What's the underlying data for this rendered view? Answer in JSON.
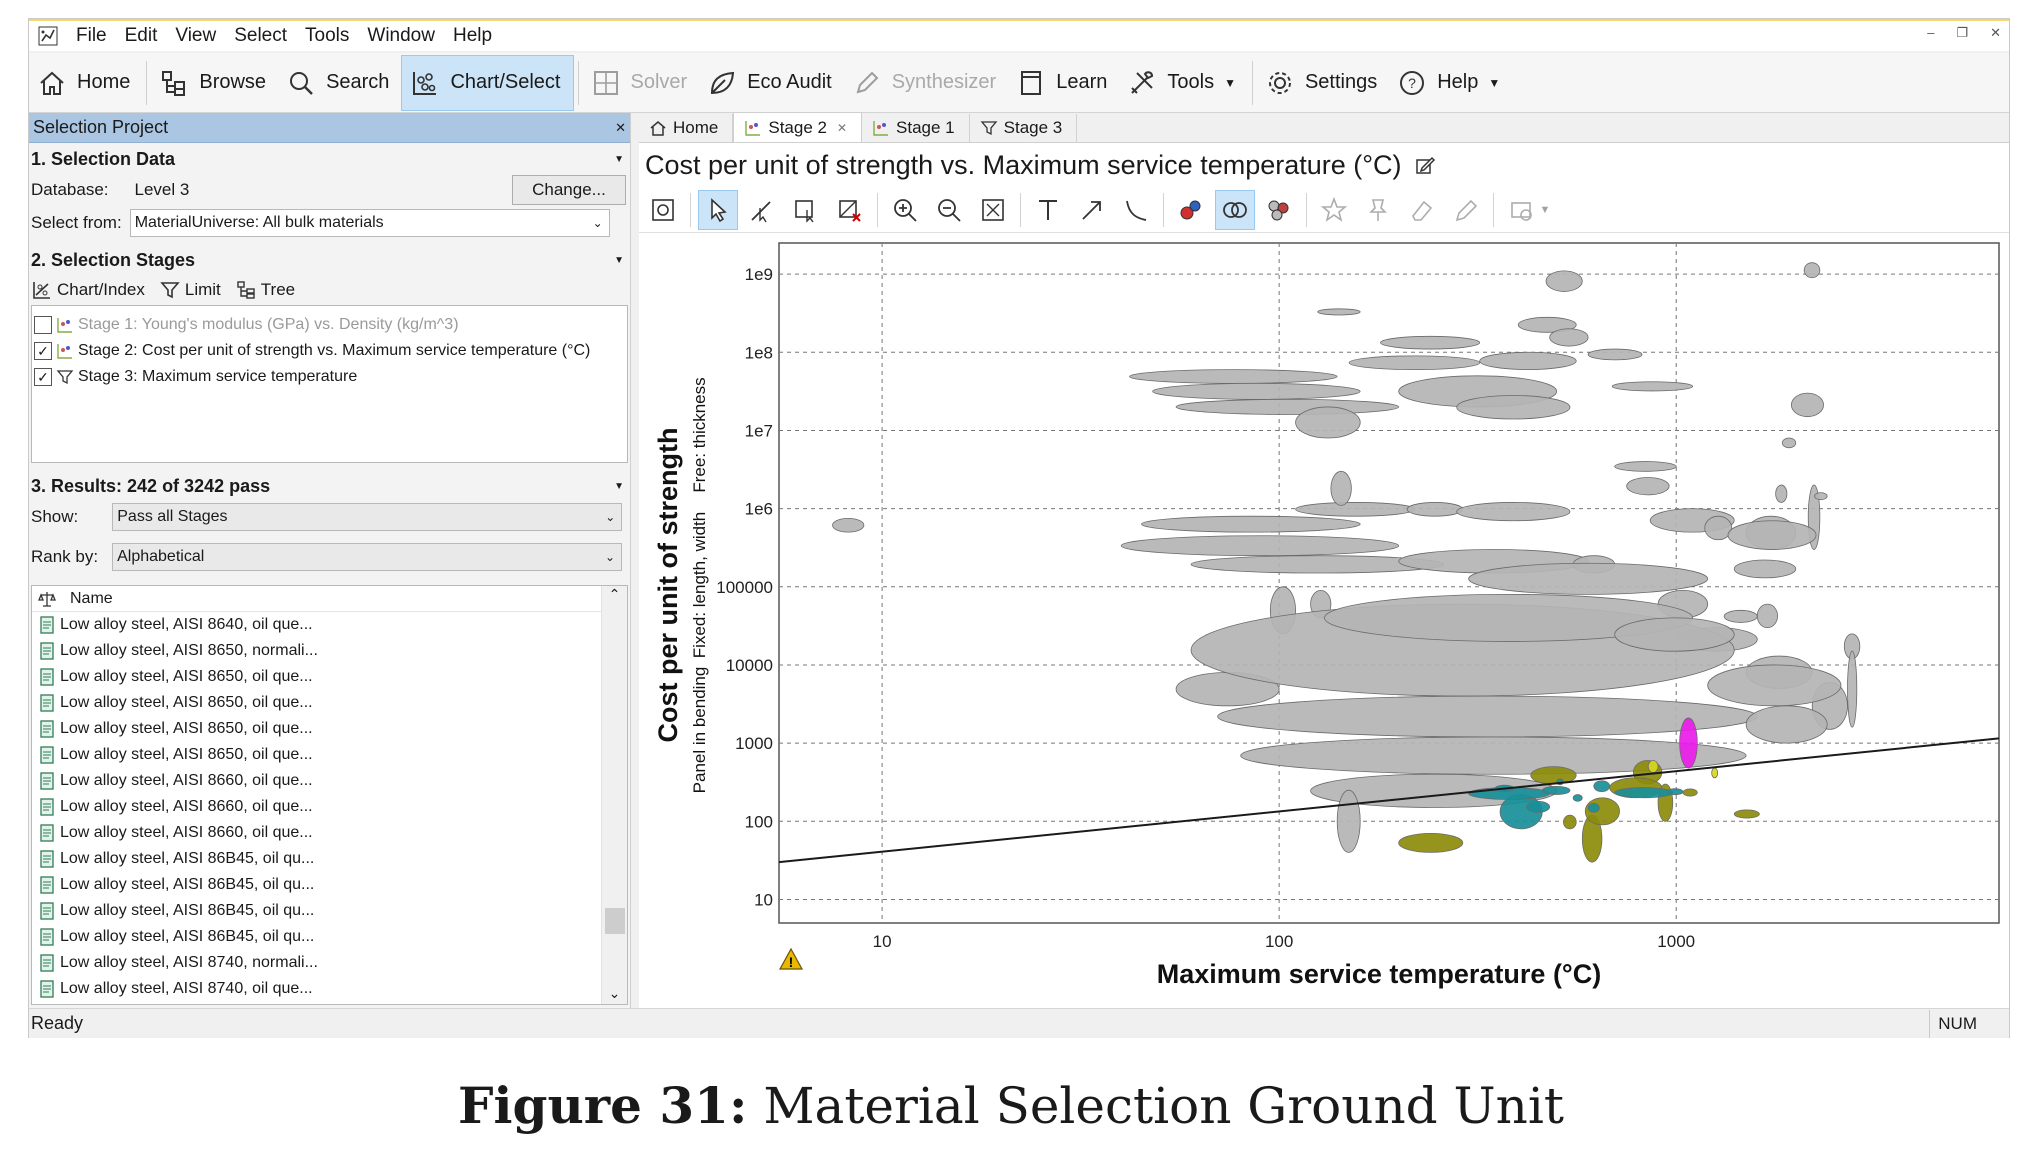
{
  "menu": {
    "items": [
      "File",
      "Edit",
      "View",
      "Select",
      "Tools",
      "Window",
      "Help"
    ]
  },
  "toolbar": {
    "home": "Home",
    "browse": "Browse",
    "search": "Search",
    "chart_select": "Chart/Select",
    "solver": "Solver",
    "eco_audit": "Eco Audit",
    "synthesizer": "Synthesizer",
    "learn": "Learn",
    "tools": "Tools",
    "settings": "Settings",
    "help": "Help"
  },
  "left": {
    "project_title": "Selection Project",
    "data_section": "1. Selection Data",
    "database_label": "Database:",
    "database_value": "Level 3",
    "change_button": "Change...",
    "select_from_label": "Select from:",
    "select_from_value": "MaterialUniverse: All bulk materials",
    "stages_section": "2. Selection Stages",
    "stage_tools": {
      "chart_index": "Chart/Index",
      "limit": "Limit",
      "tree": "Tree"
    },
    "stages": [
      {
        "label": "Stage 1: Young's modulus (GPa) vs. Density (kg/m^3)",
        "checked": false
      },
      {
        "label": "Stage 2: Cost per unit of strength vs. Maximum service temperature (°C)",
        "checked": true
      },
      {
        "label": "Stage 3: Maximum service temperature",
        "checked": true
      }
    ],
    "results_section": "3. Results: 242 of 3242 pass",
    "show_label": "Show:",
    "show_value": "Pass all Stages",
    "rank_label": "Rank by:",
    "rank_value": "Alphabetical",
    "list_header": "Name",
    "results": [
      "Low alloy steel, AISI 8640, oil que...",
      "Low alloy steel, AISI 8650, normali...",
      "Low alloy steel, AISI 8650, oil que...",
      "Low alloy steel, AISI 8650, oil que...",
      "Low alloy steel, AISI 8650, oil que...",
      "Low alloy steel, AISI 8650, oil que...",
      "Low alloy steel, AISI 8660, oil que...",
      "Low alloy steel, AISI 8660, oil que...",
      "Low alloy steel, AISI 8660, oil que...",
      "Low alloy steel, AISI 86B45, oil qu...",
      "Low alloy steel, AISI 86B45, oil qu...",
      "Low alloy steel, AISI 86B45, oil qu...",
      "Low alloy steel, AISI 86B45, oil qu...",
      "Low alloy steel, AISI 8740, normali...",
      "Low alloy steel, AISI 8740, oil que..."
    ]
  },
  "tabs": [
    {
      "label": "Home",
      "active": false
    },
    {
      "label": "Stage 2",
      "active": true
    },
    {
      "label": "Stage 1",
      "active": false
    },
    {
      "label": "Stage 3",
      "active": false
    }
  ],
  "chart_title": "Cost per unit of strength vs. Maximum service temperature (°C)",
  "status": {
    "text": "Ready",
    "num": "NUM"
  },
  "caption": {
    "label": "Figure 31:",
    "text": "Material Selection Ground Unit"
  },
  "colors": {
    "bubble": "#b4b4b4",
    "teal": "#178f98",
    "olive": "#8c8c0a",
    "yellow": "#d8d820",
    "magenta": "#ea1cea",
    "active_bg": "#cce4f7"
  },
  "chart_data": {
    "type": "scatter",
    "title": "",
    "xlabel": "Maximum service temperature (°C)",
    "ylabel": "Cost per unit of strength",
    "ylabel_sub1": "Panel in bending",
    "ylabel_sub2": "Fixed: length, width",
    "ylabel_sub3": "Free: thickness",
    "xscale": "log",
    "yscale": "log",
    "xlim": [
      5.5,
      6500
    ],
    "ylim": [
      5,
      2500000000.0
    ],
    "xticks": [
      {
        "v": 10,
        "label": "10"
      },
      {
        "v": 100,
        "label": "100"
      },
      {
        "v": 1000,
        "label": "1000"
      }
    ],
    "yticks": [
      {
        "v": 10,
        "label": "10"
      },
      {
        "v": 100,
        "label": "100"
      },
      {
        "v": 1000,
        "label": "1000"
      },
      {
        "v": 10000,
        "label": "10000"
      },
      {
        "v": 100000,
        "label": "100000"
      },
      {
        "v": 1000000,
        "label": "1e6"
      },
      {
        "v": 10000000,
        "label": "1e7"
      },
      {
        "v": 100000000,
        "label": "1e8"
      },
      {
        "v": 1000000000,
        "label": "1e9"
      }
    ],
    "grid": true,
    "selection_line": {
      "x": [
        5.5,
        6500
      ],
      "y": [
        30,
        1150
      ]
    },
    "bubbles": [
      {
        "x": [
          7.5,
          9
        ],
        "y": [
          500000,
          750000
        ],
        "c": "grey"
      },
      {
        "x": [
          42,
          140
        ],
        "y": [
          40000000.0,
          60000000.0
        ],
        "c": "grey"
      },
      {
        "x": [
          48,
          160
        ],
        "y": [
          25000000.0,
          40000000.0
        ],
        "c": "grey"
      },
      {
        "x": [
          55,
          200
        ],
        "y": [
          16000000.0,
          25000000.0
        ],
        "c": "grey"
      },
      {
        "x": [
          150,
          320
        ],
        "y": [
          60000000.0,
          90000000.0
        ],
        "c": "grey"
      },
      {
        "x": [
          180,
          320
        ],
        "y": [
          110000000.0,
          160000000.0
        ],
        "c": "grey"
      },
      {
        "x": [
          200,
          500
        ],
        "y": [
          20000000.0,
          50000000.0
        ],
        "c": "grey"
      },
      {
        "x": [
          320,
          560
        ],
        "y": [
          60000000.0,
          100000000.0
        ],
        "c": "grey"
      },
      {
        "x": [
          400,
          560
        ],
        "y": [
          180000000.0,
          280000000.0
        ],
        "c": "grey"
      },
      {
        "x": [
          470,
          580
        ],
        "y": [
          600000000.0,
          1100000000.0
        ],
        "c": "grey"
      },
      {
        "x": [
          480,
          600
        ],
        "y": [
          120000000.0,
          200000000.0
        ],
        "c": "grey"
      },
      {
        "x": [
          600,
          820
        ],
        "y": [
          80000000.0,
          110000000.0
        ],
        "c": "grey"
      },
      {
        "x": [
          690,
          1100
        ],
        "y": [
          32000000.0,
          42000000.0
        ],
        "c": "grey"
      },
      {
        "x": [
          280,
          540
        ],
        "y": [
          14000000.0,
          28000000.0
        ],
        "c": "grey"
      },
      {
        "x": [
          110,
          160
        ],
        "y": [
          8000000.0,
          20000000.0
        ],
        "c": "grey"
      },
      {
        "x": [
          125,
          160
        ],
        "y": [
          300000000.0,
          360000000.0
        ],
        "c": "grey"
      },
      {
        "x": [
          1950,
          2350
        ],
        "y": [
          15000000.0,
          30000000.0
        ],
        "c": "grey"
      },
      {
        "x": [
          1850,
          2000
        ],
        "y": [
          6000000.0,
          8000000.0
        ],
        "c": "grey"
      },
      {
        "x": [
          2100,
          2300
        ],
        "y": [
          900000000.0,
          1400000000.0
        ],
        "c": "grey"
      },
      {
        "x": [
          45,
          160
        ],
        "y": [
          500000.0,
          800000.0
        ],
        "c": "grey"
      },
      {
        "x": [
          40,
          200
        ],
        "y": [
          250000.0,
          450000.0
        ],
        "c": "grey"
      },
      {
        "x": [
          60,
          260
        ],
        "y": [
          150000.0,
          250000.0
        ],
        "c": "grey"
      },
      {
        "x": [
          110,
          220
        ],
        "y": [
          800000.0,
          1200000.0
        ],
        "c": "grey"
      },
      {
        "x": [
          135,
          152
        ],
        "y": [
          1100000.0,
          3000000.0
        ],
        "c": "grey"
      },
      {
        "x": [
          210,
          290
        ],
        "y": [
          800000.0,
          1200000.0
        ],
        "c": "grey"
      },
      {
        "x": [
          280,
          540
        ],
        "y": [
          700000.0,
          1200000.0
        ],
        "c": "grey"
      },
      {
        "x": [
          200,
          600
        ],
        "y": [
          150000.0,
          300000.0
        ],
        "c": "grey"
      },
      {
        "x": [
          550,
          700
        ],
        "y": [
          150000.0,
          250000.0
        ],
        "c": "grey"
      },
      {
        "x": [
          700,
          1000
        ],
        "y": [
          3000000.0,
          4000000.0
        ],
        "c": "grey"
      },
      {
        "x": [
          750,
          960
        ],
        "y": [
          1500000.0,
          2500000.0
        ],
        "c": "grey"
      },
      {
        "x": [
          860,
          1400
        ],
        "y": [
          500000.0,
          1000000.0
        ],
        "c": "grey"
      },
      {
        "x": [
          1180,
          1380
        ],
        "y": [
          400000.0,
          800000.0
        ],
        "c": "grey"
      },
      {
        "x": [
          1400,
          2000
        ],
        "y": [
          130000.0,
          220000.0
        ],
        "c": "grey"
      },
      {
        "x": [
          1500,
          2000
        ],
        "y": [
          300000.0,
          800000.0
        ],
        "c": "grey"
      },
      {
        "x": [
          1780,
          1900
        ],
        "y": [
          1200000.0,
          2000000.0
        ],
        "c": "grey"
      },
      {
        "x": [
          2150,
          2300
        ],
        "y": [
          300000.0,
          2000000.0
        ],
        "c": "grey"
      },
      {
        "x": [
          2230,
          2400
        ],
        "y": [
          1300000.0,
          1600000.0
        ],
        "c": "grey"
      },
      {
        "x": [
          1350,
          2250
        ],
        "y": [
          300000.0,
          700000.0
        ],
        "c": "grey"
      },
      {
        "x": [
          1000,
          1600
        ],
        "y": [
          15000.0,
          30000.0
        ],
        "c": "grey"
      },
      {
        "x": [
          900,
          1200
        ],
        "y": [
          40000.0,
          90000.0
        ],
        "c": "grey"
      },
      {
        "x": [
          1320,
          1600
        ],
        "y": [
          35000.0,
          50000.0
        ],
        "c": "grey"
      },
      {
        "x": [
          1600,
          1800
        ],
        "y": [
          30000.0,
          60000.0
        ],
        "c": "grey"
      },
      {
        "x": [
          2650,
          2900
        ],
        "y": [
          12000.0,
          25000.0
        ],
        "c": "grey"
      },
      {
        "x": [
          1500,
          2200
        ],
        "y": [
          5000.0,
          13000.0
        ],
        "c": "grey"
      },
      {
        "x": [
          2200,
          2700
        ],
        "y": [
          1500.0,
          6000.0
        ],
        "c": "grey"
      },
      {
        "x": [
          2700,
          2850
        ],
        "y": [
          1600.0,
          15000.0
        ],
        "c": "grey"
      },
      {
        "x": [
          95,
          110
        ],
        "y": [
          25000.0,
          100000.0
        ],
        "c": "grey"
      },
      {
        "x": [
          120,
          135
        ],
        "y": [
          40000.0,
          90000.0
        ],
        "c": "grey"
      },
      {
        "x": [
          55,
          100
        ],
        "y": [
          3000.0,
          8000.0
        ],
        "c": "grey"
      },
      {
        "x": [
          60,
          1400
        ],
        "y": [
          4000.0,
          60000.0
        ],
        "c": "grey"
      },
      {
        "x": [
          70,
          1600
        ],
        "y": [
          1200.0,
          4000.0
        ],
        "c": "grey"
      },
      {
        "x": [
          80,
          1500
        ],
        "y": [
          400,
          1200
        ],
        "c": "grey"
      },
      {
        "x": [
          120,
          500
        ],
        "y": [
          150,
          400
        ],
        "c": "grey"
      },
      {
        "x": [
          140,
          160
        ],
        "y": [
          40,
          250
        ],
        "c": "grey"
      },
      {
        "x": [
          130,
          1100
        ],
        "y": [
          20000.0,
          80000.0
        ],
        "c": "grey"
      },
      {
        "x": [
          300,
          1200
        ],
        "y": [
          80000.0,
          200000.0
        ],
        "c": "grey"
      },
      {
        "x": [
          700,
          1400
        ],
        "y": [
          15000.0,
          40000.0
        ],
        "c": "grey"
      },
      {
        "x": [
          1200,
          2600
        ],
        "y": [
          3000.0,
          10000.0
        ],
        "c": "grey"
      },
      {
        "x": [
          1500,
          2400
        ],
        "y": [
          1000.0,
          3000.0
        ],
        "c": "grey"
      },
      {
        "x": [
          430,
          560
        ],
        "y": [
          300,
          500
        ],
        "c": "olive"
      },
      {
        "x": [
          780,
          920
        ],
        "y": [
          300,
          600
        ],
        "c": "olive"
      },
      {
        "x": [
          200,
          290
        ],
        "y": [
          40,
          70
        ],
        "c": "olive"
      },
      {
        "x": [
          580,
          650
        ],
        "y": [
          30,
          120
        ],
        "c": "olive"
      },
      {
        "x": [
          590,
          720
        ],
        "y": [
          90,
          200
        ],
        "c": "olive"
      },
      {
        "x": [
          680,
          920
        ],
        "y": [
          200,
          360
        ],
        "c": "olive"
      },
      {
        "x": [
          900,
          980
        ],
        "y": [
          100,
          300
        ],
        "c": "olive"
      },
      {
        "x": [
          520,
          560
        ],
        "y": [
          80,
          120
        ],
        "c": "olive"
      },
      {
        "x": [
          1400,
          1620
        ],
        "y": [
          110,
          140
        ],
        "c": "olive"
      },
      {
        "x": [
          1040,
          1130
        ],
        "y": [
          210,
          260
        ],
        "c": "olive"
      },
      {
        "x": [
          850,
          900
        ],
        "y": [
          420,
          600
        ],
        "c": "yellow"
      },
      {
        "x": [
          1235,
          1265
        ],
        "y": [
          360,
          480
        ],
        "c": "yellow"
      },
      {
        "x": [
          1020,
          1130
        ],
        "y": [
          480,
          2100
        ],
        "c": "magenta"
      },
      {
        "x": [
          360,
          460
        ],
        "y": [
          80,
          220
        ],
        "c": "teal"
      },
      {
        "x": [
          300,
          480
        ],
        "y": [
          190,
          270
        ],
        "c": "teal"
      },
      {
        "x": [
          460,
          540
        ],
        "y": [
          220,
          280
        ],
        "c": "teal"
      },
      {
        "x": [
          420,
          480
        ],
        "y": [
          130,
          180
        ],
        "c": "teal"
      },
      {
        "x": [
          620,
          680
        ],
        "y": [
          240,
          330
        ],
        "c": "teal"
      },
      {
        "x": [
          700,
          980
        ],
        "y": [
          200,
          270
        ],
        "c": "teal"
      },
      {
        "x": [
          600,
          640
        ],
        "y": [
          130,
          170
        ],
        "c": "teal"
      },
      {
        "x": [
          550,
          580
        ],
        "y": [
          180,
          220
        ],
        "c": "teal"
      },
      {
        "x": [
          350,
          390
        ],
        "y": [
          240,
          290
        ],
        "c": "teal"
      },
      {
        "x": [
          950,
          1040
        ],
        "y": [
          220,
          260
        ],
        "c": "teal"
      },
      {
        "x": [
          500,
          520
        ],
        "y": [
          300,
          340
        ],
        "c": "teal"
      }
    ]
  }
}
